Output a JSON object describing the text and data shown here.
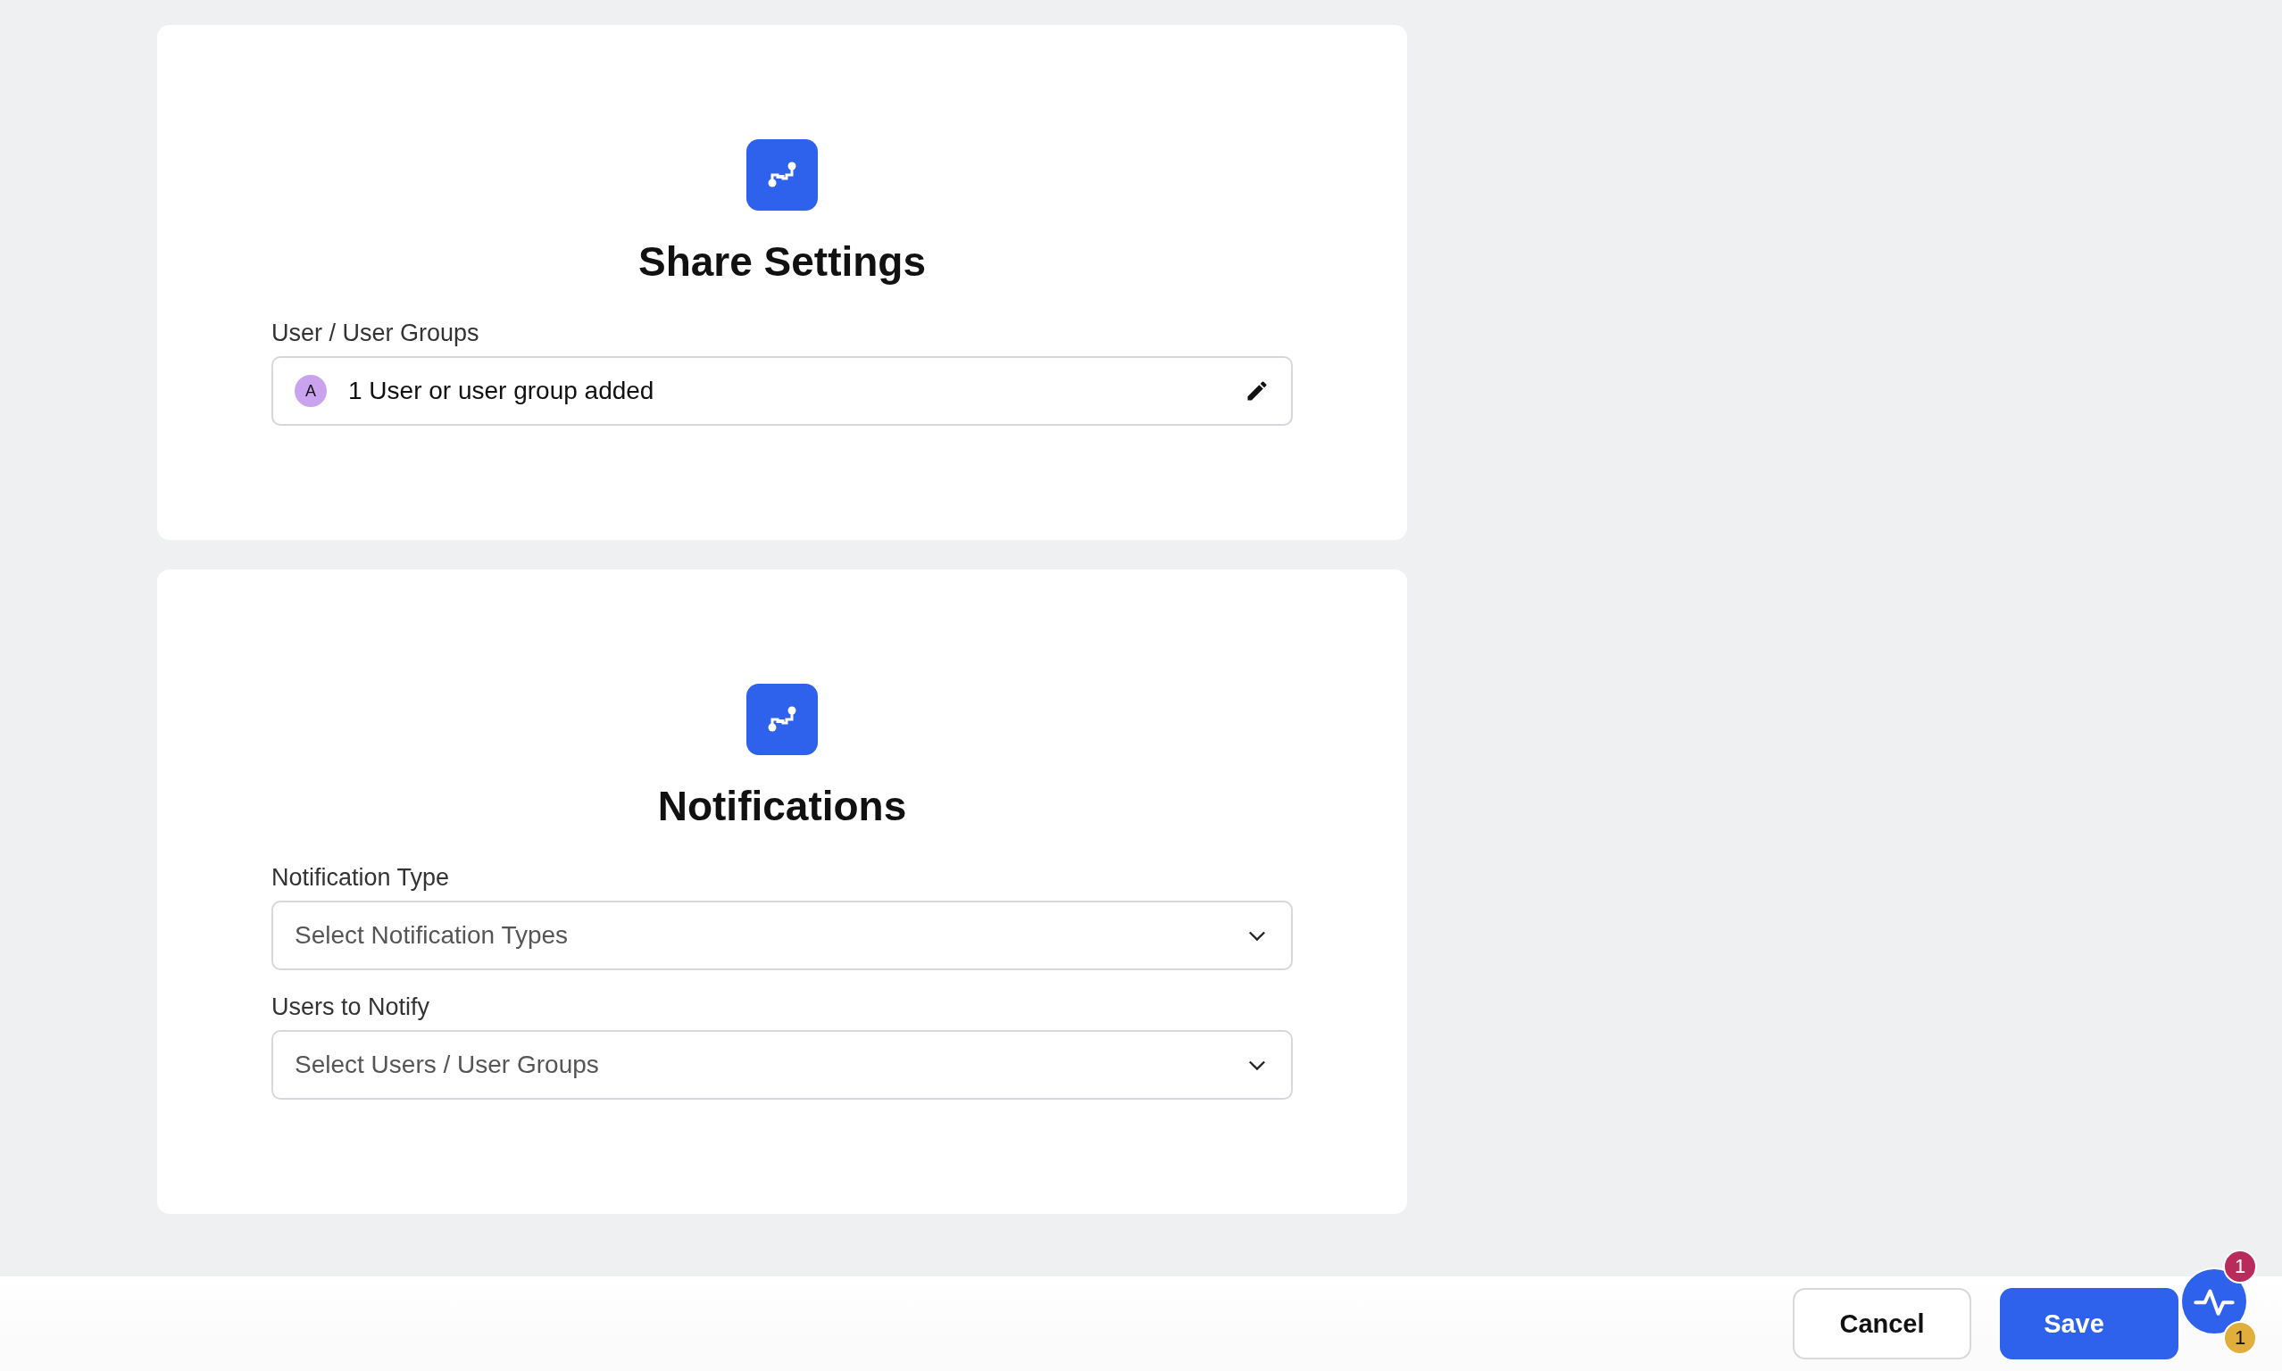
{
  "sections": [
    {
      "title": "Share Settings",
      "fields": [
        {
          "kind": "value",
          "label": "User / User Groups",
          "avatar": "A",
          "value": "1 User or user group added"
        }
      ]
    },
    {
      "title": "Notifications",
      "fields": [
        {
          "kind": "select",
          "label": "Notification Type",
          "placeholder": "Select Notification Types"
        },
        {
          "kind": "select",
          "label": "Users to Notify",
          "placeholder": "Select Users / User Groups"
        }
      ]
    }
  ],
  "footer": {
    "buttons": [
      {
        "kind": "secondary",
        "label": "Cancel"
      },
      {
        "kind": "primary",
        "label": "Save"
      }
    ]
  },
  "widget": {
    "badges": [
      {
        "count": "1",
        "color": "#b92b5b"
      },
      {
        "count": "1",
        "color": "#e1ae3c"
      }
    ]
  }
}
